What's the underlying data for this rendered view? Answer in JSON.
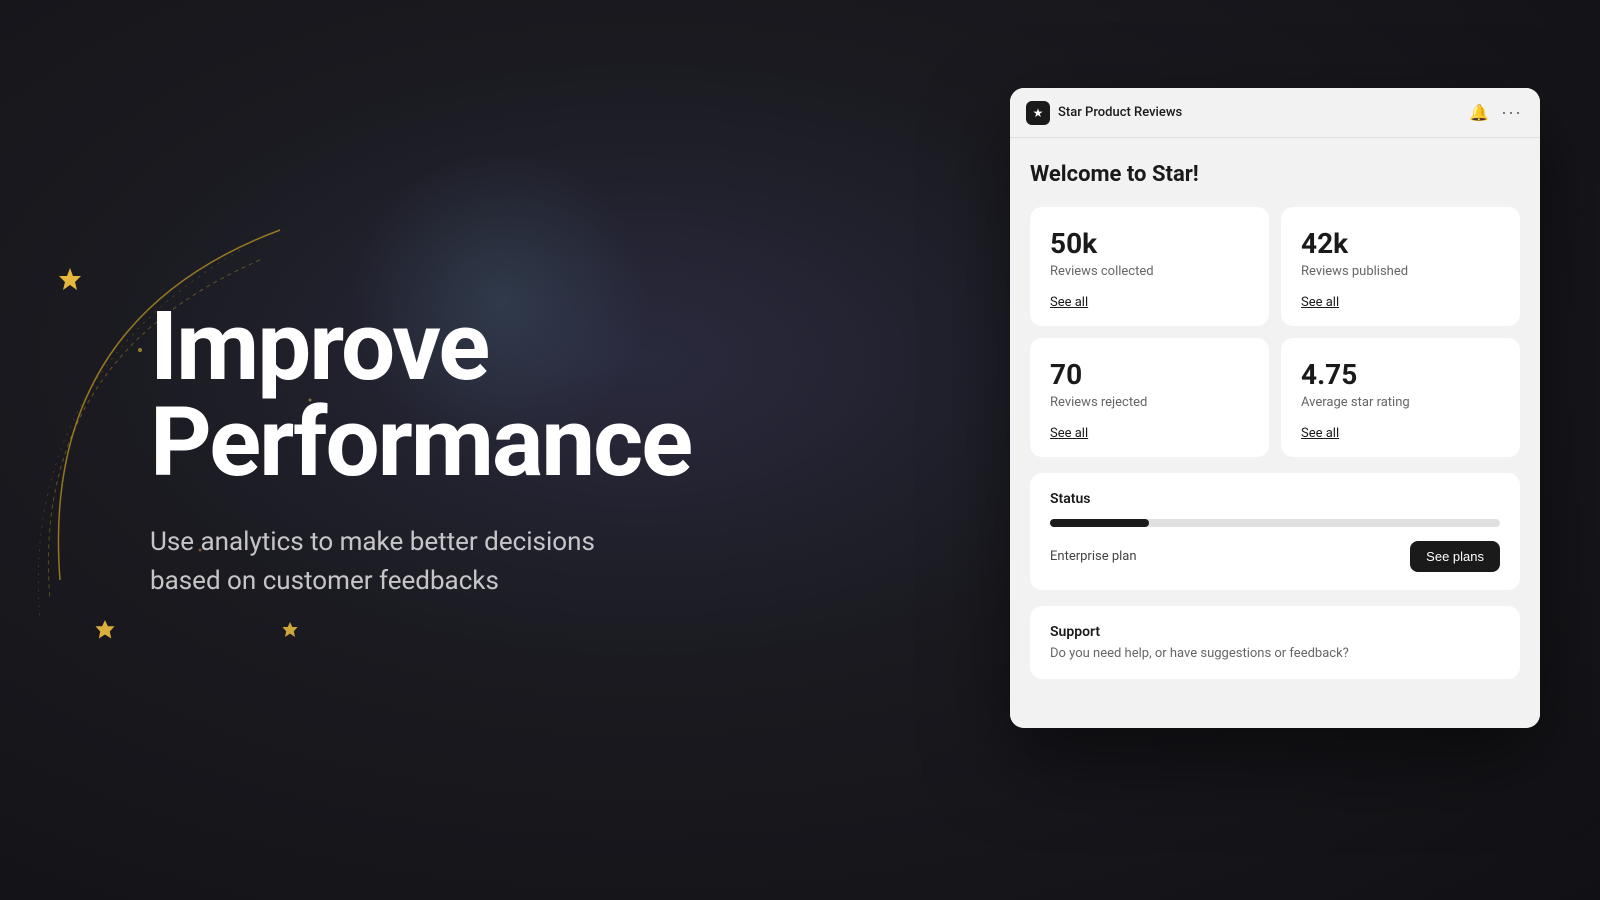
{
  "background": {
    "color": "#1a1a1f"
  },
  "hero": {
    "title_line1": "Improve",
    "title_line2": "Performance",
    "subtitle": "Use analytics to make better decisions based on customer feedbacks"
  },
  "app_window": {
    "title": "Star Product Reviews",
    "welcome": "Welcome to Star!",
    "bell_icon": "🔔",
    "more_icon": "⋯",
    "stats": [
      {
        "value": "50k",
        "label": "Reviews collected",
        "link": "See all"
      },
      {
        "value": "42k",
        "label": "Reviews published",
        "link": "See all"
      },
      {
        "value": "70",
        "label": "Reviews rejected",
        "link": "See all"
      },
      {
        "value": "4.75",
        "label": "Average star rating",
        "link": "See all"
      }
    ],
    "status": {
      "label": "Status",
      "progress_percent": 22,
      "plan": "Enterprise plan",
      "see_plans_btn": "See plans"
    },
    "support": {
      "title": "Support",
      "text": "Do you need help, or have suggestions or feedback?"
    }
  },
  "decorative": {
    "star_color": "#f0c040",
    "arc_color": "#c8a020"
  }
}
